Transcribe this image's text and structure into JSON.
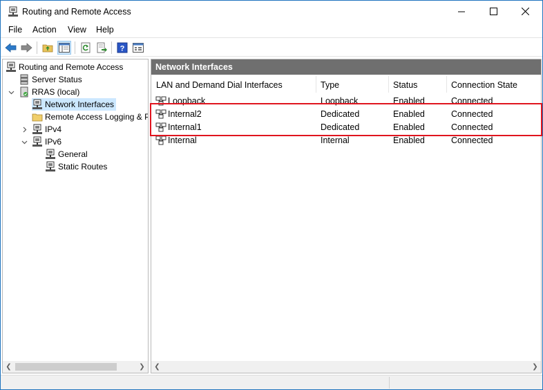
{
  "window": {
    "title": "Routing and Remote Access"
  },
  "menu": [
    "File",
    "Action",
    "View",
    "Help"
  ],
  "toolbar": {
    "icons": [
      "back-arrow-icon",
      "forward-arrow-icon",
      "up-folder-icon",
      "show-hide-tree-icon",
      "refresh-icon",
      "export-list-icon",
      "help-icon",
      "properties-icon"
    ]
  },
  "tree": {
    "root": "Routing and Remote Access",
    "server_status": "Server Status",
    "server": "RRAS (local)",
    "network_interfaces": "Network Interfaces",
    "remote_access_logging": "Remote Access Logging & P",
    "ipv4": "IPv4",
    "ipv6": "IPv6",
    "general": "General",
    "static_routes": "Static Routes"
  },
  "right_pane": {
    "header": "Network Interfaces",
    "columns": [
      "LAN and Demand Dial Interfaces",
      "Type",
      "Status",
      "Connection State"
    ],
    "rows": [
      [
        "Loopback",
        "Loopback",
        "Enabled",
        "Connected"
      ],
      [
        "Internal2",
        "Dedicated",
        "Enabled",
        "Connected"
      ],
      [
        "Internal1",
        "Dedicated",
        "Enabled",
        "Connected"
      ],
      [
        "Internal",
        "Internal",
        "Enabled",
        "Connected"
      ]
    ]
  },
  "colors": {
    "highlight_border": "#e0141e",
    "pane_header": "#6f6f6f",
    "selection": "#cce8ff",
    "window_border": "#1e73be"
  }
}
